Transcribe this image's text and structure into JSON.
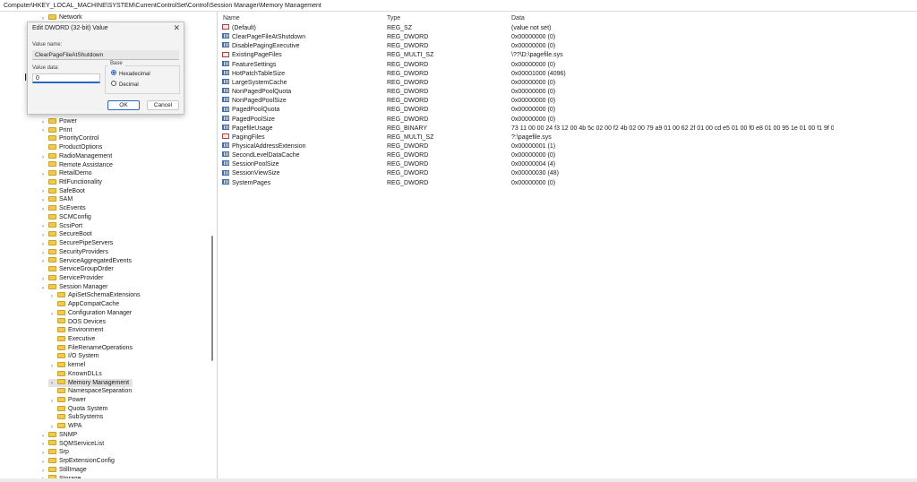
{
  "address": "Computer\\HKEY_LOCAL_MACHINE\\SYSTEM\\CurrentControlSet\\Control\\Session Manager\\Memory Management",
  "tree": {
    "items": [
      {
        "label": "Network",
        "expand": true,
        "indent": 1
      },
      {
        "label": "Power",
        "expand": true,
        "indent": 1
      },
      {
        "label": "Print",
        "expand": true,
        "indent": 1
      },
      {
        "label": "PriorityControl",
        "expand": false,
        "indent": 1
      },
      {
        "label": "ProductOptions",
        "expand": false,
        "indent": 1
      },
      {
        "label": "RadioManagement",
        "expand": true,
        "indent": 1
      },
      {
        "label": "Remote Assistance",
        "expand": false,
        "indent": 1
      },
      {
        "label": "RetailDemo",
        "expand": true,
        "indent": 1
      },
      {
        "label": "RtlFunctionality",
        "expand": false,
        "indent": 1
      },
      {
        "label": "SafeBoot",
        "expand": true,
        "indent": 1
      },
      {
        "label": "SAM",
        "expand": true,
        "indent": 1
      },
      {
        "label": "ScEvents",
        "expand": true,
        "indent": 1
      },
      {
        "label": "SCMConfig",
        "expand": false,
        "indent": 1
      },
      {
        "label": "ScsiPort",
        "expand": true,
        "indent": 1
      },
      {
        "label": "SecureBoot",
        "expand": true,
        "indent": 1
      },
      {
        "label": "SecurePipeServers",
        "expand": true,
        "indent": 1
      },
      {
        "label": "SecurityProviders",
        "expand": true,
        "indent": 1
      },
      {
        "label": "ServiceAggregatedEvents",
        "expand": true,
        "indent": 1
      },
      {
        "label": "ServiceGroupOrder",
        "expand": false,
        "indent": 1
      },
      {
        "label": "ServiceProvider",
        "expand": true,
        "indent": 1
      },
      {
        "label": "Session Manager",
        "expand": "open",
        "indent": 1
      },
      {
        "label": "ApiSetSchemaExtensions",
        "expand": true,
        "indent": 2
      },
      {
        "label": "AppCompatCache",
        "expand": false,
        "indent": 2
      },
      {
        "label": "Configuration Manager",
        "expand": true,
        "indent": 2
      },
      {
        "label": "DOS Devices",
        "expand": false,
        "indent": 2
      },
      {
        "label": "Environment",
        "expand": false,
        "indent": 2
      },
      {
        "label": "Executive",
        "expand": false,
        "indent": 2
      },
      {
        "label": "FileRenameOperations",
        "expand": false,
        "indent": 2
      },
      {
        "label": "I/O System",
        "expand": false,
        "indent": 2
      },
      {
        "label": "kernel",
        "expand": true,
        "indent": 2
      },
      {
        "label": "KnownDLLs",
        "expand": false,
        "indent": 2
      },
      {
        "label": "Memory Management",
        "expand": true,
        "indent": 2,
        "selected": true
      },
      {
        "label": "NamespaceSeparation",
        "expand": false,
        "indent": 2
      },
      {
        "label": "Power",
        "expand": true,
        "indent": 2
      },
      {
        "label": "Quota System",
        "expand": false,
        "indent": 2
      },
      {
        "label": "SubSystems",
        "expand": false,
        "indent": 2
      },
      {
        "label": "WPA",
        "expand": true,
        "indent": 2
      },
      {
        "label": "SNMP",
        "expand": true,
        "indent": 1
      },
      {
        "label": "SQMServiceList",
        "expand": true,
        "indent": 1
      },
      {
        "label": "Srp",
        "expand": true,
        "indent": 1
      },
      {
        "label": "SrpExtensionConfig",
        "expand": true,
        "indent": 1
      },
      {
        "label": "StillImage",
        "expand": true,
        "indent": 1
      },
      {
        "label": "Storage",
        "expand": true,
        "indent": 1
      }
    ]
  },
  "list": {
    "headers": {
      "name": "Name",
      "type": "Type",
      "data": "Data"
    },
    "rows": [
      {
        "name": "(Default)",
        "type": "REG_SZ",
        "data": "(value not set)",
        "icon": "string"
      },
      {
        "name": "ClearPageFileAtShutdown",
        "type": "REG_DWORD",
        "data": "0x00000000 (0)",
        "icon": "binary"
      },
      {
        "name": "DisablePagingExecutive",
        "type": "REG_DWORD",
        "data": "0x00000000 (0)",
        "icon": "binary"
      },
      {
        "name": "ExistingPageFiles",
        "type": "REG_MULTI_SZ",
        "data": "\\??\\D:\\pagefile.sys",
        "icon": "string"
      },
      {
        "name": "FeatureSettings",
        "type": "REG_DWORD",
        "data": "0x00000000 (0)",
        "icon": "binary"
      },
      {
        "name": "HotPatchTableSize",
        "type": "REG_DWORD",
        "data": "0x00001000 (4096)",
        "icon": "binary"
      },
      {
        "name": "LargeSystemCache",
        "type": "REG_DWORD",
        "data": "0x00000000 (0)",
        "icon": "binary"
      },
      {
        "name": "NonPagedPoolQuota",
        "type": "REG_DWORD",
        "data": "0x00000000 (0)",
        "icon": "binary"
      },
      {
        "name": "NonPagedPoolSize",
        "type": "REG_DWORD",
        "data": "0x00000000 (0)",
        "icon": "binary"
      },
      {
        "name": "PagedPoolQuota",
        "type": "REG_DWORD",
        "data": "0x00000000 (0)",
        "icon": "binary"
      },
      {
        "name": "PagedPoolSize",
        "type": "REG_DWORD",
        "data": "0x00000000 (0)",
        "icon": "binary"
      },
      {
        "name": "PagefileUsage",
        "type": "REG_BINARY",
        "data": "73 11 00 00 24 f3 12 00 4b 5c 02 00 f2 4b 02 00 79 a9 01 00 62 2f 01 00 cd e5 01 00 f0 e8 01 00 95 1e 01 00 f1 9f 01 00 a5 01 02 0...",
        "icon": "binary"
      },
      {
        "name": "PagingFiles",
        "type": "REG_MULTI_SZ",
        "data": "?:\\pagefile.sys",
        "icon": "string"
      },
      {
        "name": "PhysicalAddressExtension",
        "type": "REG_DWORD",
        "data": "0x00000001 (1)",
        "icon": "binary"
      },
      {
        "name": "SecondLevelDataCache",
        "type": "REG_DWORD",
        "data": "0x00000000 (0)",
        "icon": "binary"
      },
      {
        "name": "SessionPoolSize",
        "type": "REG_DWORD",
        "data": "0x00000004 (4)",
        "icon": "binary"
      },
      {
        "name": "SessionViewSize",
        "type": "REG_DWORD",
        "data": "0x00000030 (48)",
        "icon": "binary"
      },
      {
        "name": "SystemPages",
        "type": "REG_DWORD",
        "data": "0x00000000 (0)",
        "icon": "binary"
      }
    ]
  },
  "dialog": {
    "title": "Edit DWORD (32-bit) Value",
    "close_glyph": "✕",
    "value_name_label": "Value name:",
    "value_name": "ClearPageFileAtShutdown",
    "value_data_label": "Value data:",
    "value_data": "0",
    "base_label": "Base",
    "base_options": [
      {
        "label": "Hexadecimal",
        "selected": true
      },
      {
        "label": "Decimal",
        "selected": false
      }
    ],
    "ok_label": "OK",
    "cancel_label": "Cancel",
    "cursor_glyph": "I"
  }
}
